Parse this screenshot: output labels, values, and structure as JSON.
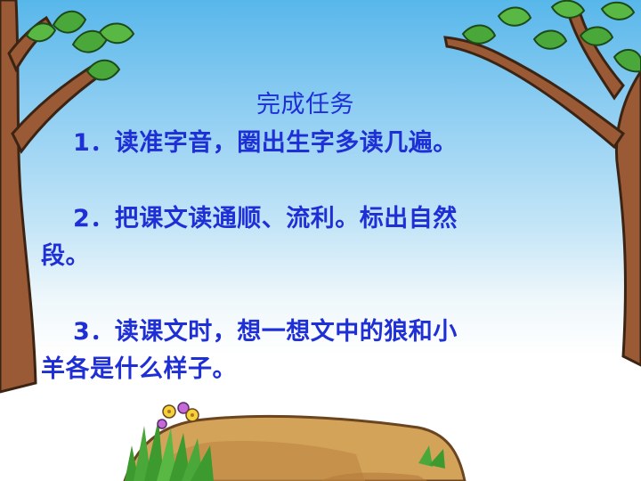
{
  "slide": {
    "title": "完成任务",
    "task_1": "1．读准字音，圈出生字多读几遍。",
    "task_2_line_1": "2．把课文读通顺、流利。标出自然",
    "task_2_line_2": "段。",
    "task_3_line_1": "3．读课文时，想一想文中的狼和小",
    "task_3_line_2": "羊各是什么样子。"
  },
  "colors": {
    "text": "#1f2fd6",
    "sky_top": "#58b7ea",
    "tree_trunk": "#9a5a35",
    "leaf": "#4aa83a",
    "ground": "#d4a35a"
  }
}
